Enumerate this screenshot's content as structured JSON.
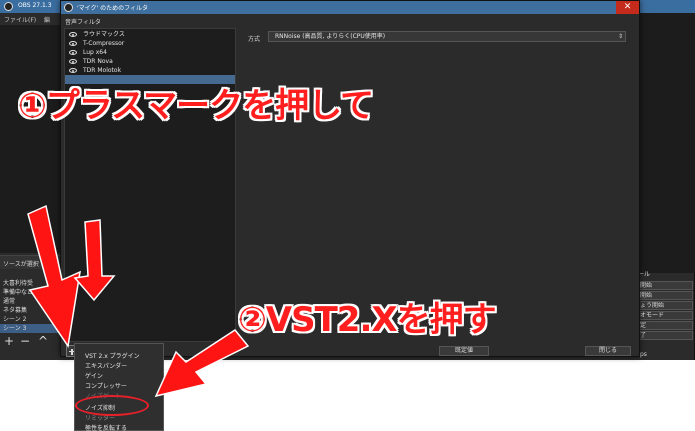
{
  "obs": {
    "title": "OBS 27.1.3",
    "menu_file": "ファイル(F)",
    "menu_edit": "編",
    "scenes_header": "ソースが選択",
    "scenes": [
      "大喜利待受",
      "準備中など",
      "通常",
      "ネタ募集",
      "シーン 2",
      "シーン 3"
    ],
    "scene_selected_index": 5,
    "scene_tools": [
      "+",
      "−",
      "^"
    ],
    "controls_header": "ール",
    "controls": [
      "開始",
      "開始",
      "ょう開始",
      "オモード",
      "定",
      "了"
    ],
    "controls_tail": "ps"
  },
  "filter_dialog": {
    "title": "'マイク' のためのフィルタ",
    "close_symbol": "✕",
    "audio_filters_label": "音声フィルタ",
    "filters": [
      "ラウドマックス",
      "T-Compressor",
      "Lup x64",
      "TDR Nova",
      "TDR Molotok"
    ],
    "selected_filter_index": 5,
    "method_label": "方式",
    "method_value": "RNNoise (高品質, よりらく(CPU使用率)",
    "defaults_button": "既定値",
    "close_button": "閉じる"
  },
  "popup_menu": {
    "items": [
      "VST 2.x プラグイン",
      "エキスパンダー",
      "ゲイン",
      "コンプレッサー",
      "ノイズゲート",
      "ノイズ抑制",
      "リミッター",
      "極性を反転する"
    ]
  },
  "annotations": {
    "step1": "①プラスマークを押して",
    "step2": "②VST2.Xを押す",
    "color": "#ff1f1f"
  }
}
